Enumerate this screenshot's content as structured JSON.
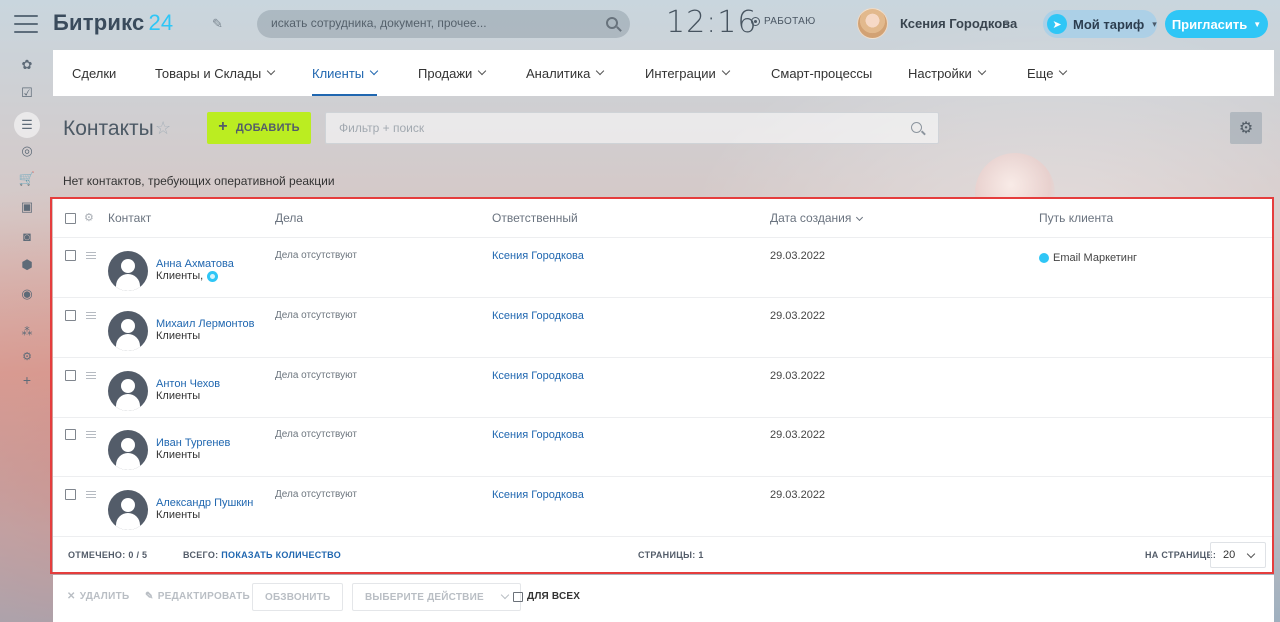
{
  "brand": {
    "name": "Битрикс",
    "number": "24"
  },
  "header": {
    "search_placeholder": "искать сотрудника, документ, прочее...",
    "clock": "12:16",
    "work_status": "РАБОТАЮ",
    "user_name": "Ксения Городкова",
    "tariff_label": "Мой тариф",
    "invite_label": "Пригласить"
  },
  "sidebar": {
    "icons": [
      "tasks-icon",
      "checklist-icon",
      "crm-filter-icon",
      "target-icon",
      "cart-icon",
      "contact-card-icon",
      "robot-icon",
      "box-icon",
      "chevron-circle-icon",
      "sitemap-icon",
      "settings-icon",
      "plus-icon"
    ]
  },
  "topnav": {
    "items": [
      {
        "label": "Сделки",
        "caret": false,
        "active": false
      },
      {
        "label": "Товары и Склады",
        "caret": true,
        "active": false
      },
      {
        "label": "Клиенты",
        "caret": true,
        "active": true
      },
      {
        "label": "Продажи",
        "caret": true,
        "active": false
      },
      {
        "label": "Аналитика",
        "caret": true,
        "active": false
      },
      {
        "label": "Интеграции",
        "caret": true,
        "active": false
      },
      {
        "label": "Смарт-процессы",
        "caret": false,
        "active": false
      },
      {
        "label": "Настройки",
        "caret": true,
        "active": false
      },
      {
        "label": "Еще",
        "caret": true,
        "active": false
      }
    ]
  },
  "page": {
    "title": "Контакты",
    "add_label": "ДОБАВИТЬ",
    "filter_placeholder": "Фильтр + поиск",
    "notice": "Нет контактов, требующих оперативной реакции"
  },
  "grid": {
    "columns": [
      "Контакт",
      "Дела",
      "Ответственный",
      "Дата создания",
      "Путь клиента"
    ],
    "rows": [
      {
        "name": "Анна Ахматова",
        "type": "Клиенты,",
        "type_channel_icon": true,
        "deals": "Дела отсутствуют",
        "responsible": "Ксения Городкова",
        "created": "29.03.2022",
        "path": "Email Маркетинг"
      },
      {
        "name": "Михаил Лермонтов",
        "type": "Клиенты",
        "type_channel_icon": false,
        "deals": "Дела отсутствуют",
        "responsible": "Ксения Городкова",
        "created": "29.03.2022",
        "path": ""
      },
      {
        "name": "Антон Чехов",
        "type": "Клиенты",
        "type_channel_icon": false,
        "deals": "Дела отсутствуют",
        "responsible": "Ксения Городкова",
        "created": "29.03.2022",
        "path": ""
      },
      {
        "name": "Иван Тургенев",
        "type": "Клиенты",
        "type_channel_icon": false,
        "deals": "Дела отсутствуют",
        "responsible": "Ксения Городкова",
        "created": "29.03.2022",
        "path": ""
      },
      {
        "name": "Александр Пушкин",
        "type": "Клиенты",
        "type_channel_icon": false,
        "deals": "Дела отсутствуют",
        "responsible": "Ксения Городкова",
        "created": "29.03.2022",
        "path": ""
      }
    ],
    "footer": {
      "selected_label": "ОТМЕЧЕНО:",
      "selected_value": "0 / 5",
      "total_label": "ВСЕГО:",
      "total_link": "ПОКАЗАТЬ КОЛИЧЕСТВО",
      "pages_label": "СТРАНИЦЫ:",
      "pages_value": "1",
      "per_page_label": "НА СТРАНИЦЕ:",
      "per_page_value": "20"
    }
  },
  "actions": {
    "delete": "УДАЛИТЬ",
    "edit": "РЕДАКТИРОВАТЬ",
    "call": "ОБЗВОНИТЬ",
    "choose": "ВЫБЕРИТЕ ДЕЙСТВИЕ",
    "for_all": "ДЛЯ ВСЕХ"
  },
  "colors": {
    "accent": "#2fc6f6",
    "add_button": "#bbed21",
    "link": "#2067b0",
    "highlight_border": "#e53d3d"
  }
}
